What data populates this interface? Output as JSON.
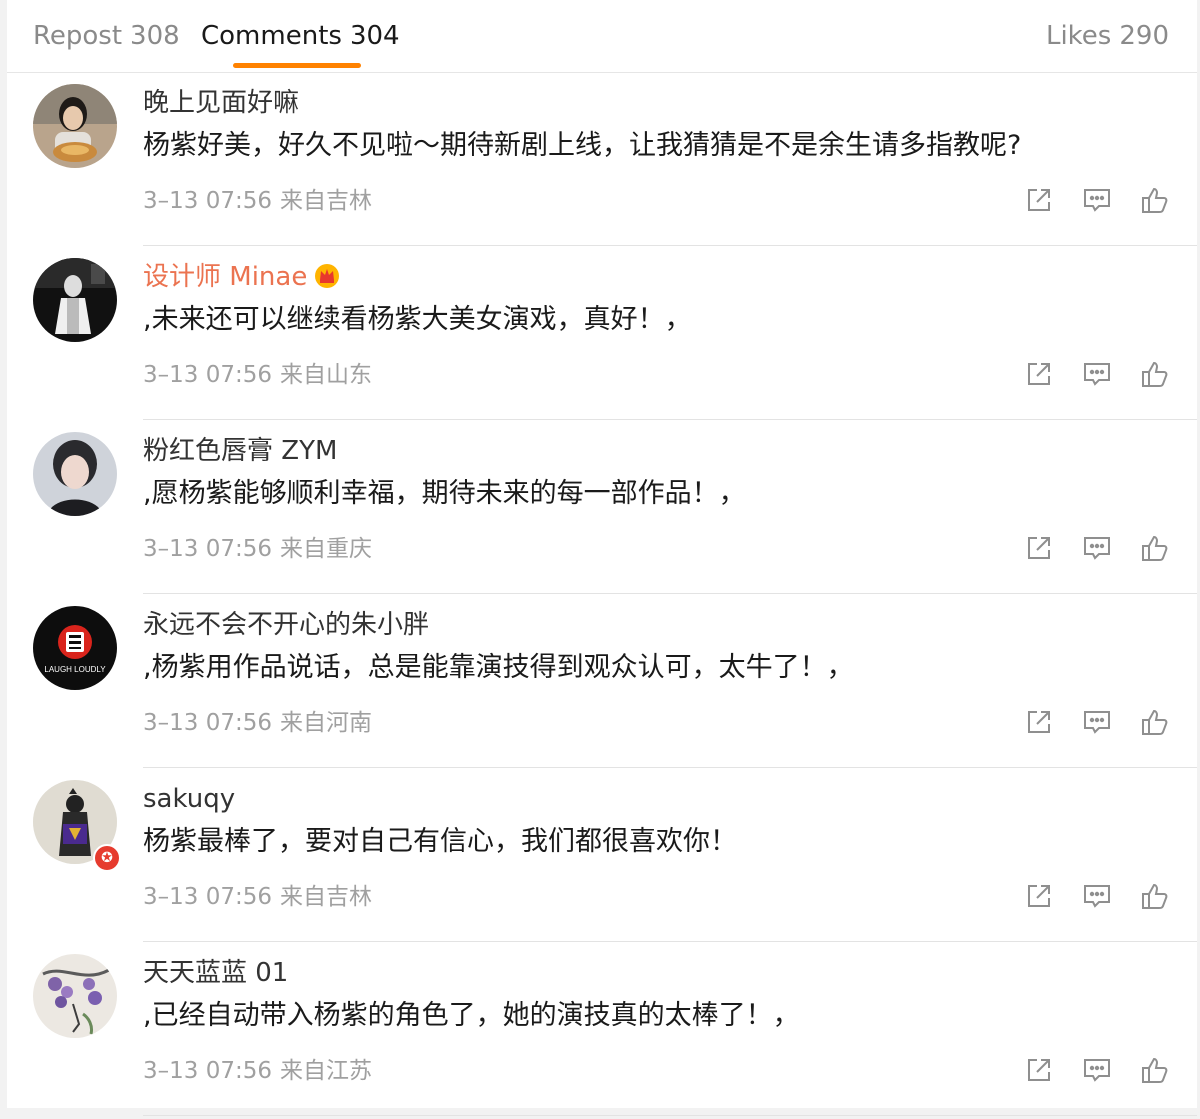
{
  "tabs": {
    "repost": {
      "label": "Repost",
      "count": "308"
    },
    "comments": {
      "label": "Comments",
      "count": "304"
    },
    "likes": {
      "label": "Likes",
      "count": "290"
    }
  },
  "colors": {
    "accent": "#ff8200",
    "vip_name": "#eb7350",
    "meta": "#a0a0a0"
  },
  "icons": [
    "share-icon",
    "comment-icon",
    "like-icon",
    "crown-icon",
    "verified-badge-icon"
  ],
  "comments": [
    {
      "user": "晚上见面好嘛",
      "text": "杨紫好美，好久不见啦～期待新剧上线，让我猜猜是不是余生请多指教呢?",
      "time": "3–13 07:56",
      "source": "来自吉林"
    },
    {
      "user": "设计师 Minae",
      "text": ",未来还可以继续看杨紫大美女演戏，真好！，",
      "time": "3–13 07:56",
      "source": "来自山东"
    },
    {
      "user": "粉红色唇膏 ZYM",
      "text": ",愿杨紫能够顺利幸福，期待未来的每一部作品！，",
      "time": "3–13 07:56",
      "source": "来自重庆"
    },
    {
      "user": "永远不会不开心的朱小胖",
      "text": ",杨紫用作品说话，总是能靠演技得到观众认可，太牛了！，",
      "time": "3–13 07:56",
      "source": "来自河南",
      "avatar_text": "LAUGH LOUDLY"
    },
    {
      "user": "sakuqy",
      "text": "杨紫最棒了，要对自己有信心，我们都很喜欢你！",
      "time": "3–13 07:56",
      "source": "来自吉林"
    },
    {
      "user": "天天蓝蓝 01",
      "text": ",已经自动带入杨紫的角色了，她的演技真的太棒了！，",
      "time": "3–13 07:56",
      "source": "来自江苏"
    }
  ]
}
